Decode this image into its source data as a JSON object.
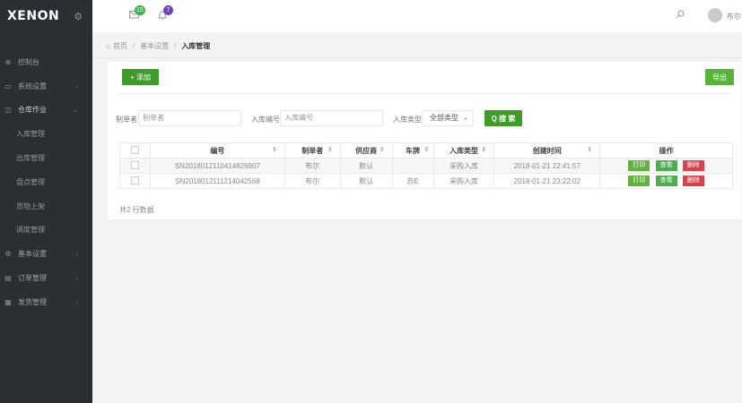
{
  "brand": {
    "logo": "XENON",
    "gear": "⚙"
  },
  "sidebar": {
    "items": [
      {
        "icon": "⊕",
        "label": "控制台",
        "arrow": "",
        "sub": false
      },
      {
        "icon": "▭",
        "label": "系统设置",
        "arrow": "›",
        "sub": false
      },
      {
        "icon": "◫",
        "label": "仓库作业",
        "arrow": "⌄",
        "sub": false,
        "open": true
      },
      {
        "icon": "",
        "label": "入库管理",
        "arrow": "",
        "sub": true
      },
      {
        "icon": "",
        "label": "出库管理",
        "arrow": "",
        "sub": true
      },
      {
        "icon": "",
        "label": "盘点管理",
        "arrow": "",
        "sub": true
      },
      {
        "icon": "",
        "label": "货物上架",
        "arrow": "",
        "sub": true
      },
      {
        "icon": "",
        "label": "调度管理",
        "arrow": "",
        "sub": true
      },
      {
        "icon": "⚙",
        "label": "基本设置",
        "arrow": "›",
        "sub": false
      },
      {
        "icon": "▤",
        "label": "订单管理",
        "arrow": "›",
        "sub": false
      },
      {
        "icon": "▦",
        "label": "发货管理",
        "arrow": "›",
        "sub": false
      }
    ]
  },
  "topbar": {
    "mail_badge": "15",
    "bell_badge": "7",
    "user_name": "布尔"
  },
  "breadcrumb": {
    "home": "首页",
    "level1": "基本设置",
    "current": "入库管理",
    "sep": "/"
  },
  "toolbar": {
    "add_label": "+ 添加",
    "export_label": "导出"
  },
  "filters": {
    "creator_label": "制单者",
    "creator_placeholder": "制单者",
    "number_label": "入库编号",
    "number_placeholder": "入库编号",
    "type_label": "入库类型",
    "type_value": "全部类型",
    "search_label": "Q 搜 索"
  },
  "table": {
    "headers": [
      "编号",
      "制单者",
      "供应商",
      "车牌",
      "入库类型",
      "创建时间",
      "操作"
    ],
    "rows": [
      {
        "id": "SN201801211041482​6907",
        "creator": "布尔",
        "supplier": "默认",
        "plate": "",
        "type": "采购入库",
        "time": "2018-01-21 22:41:57"
      },
      {
        "id": "SN2018012111214042568",
        "creator": "布尔",
        "supplier": "默认",
        "plate": "苏E",
        "type": "采购入库",
        "time": "2018-01-21 23:22:02"
      }
    ],
    "ops": {
      "print": "打印",
      "view": "查看",
      "delete": "删除"
    }
  },
  "footer": {
    "summary": "共2 行数据"
  },
  "colors": {
    "sidebar": "#2b2f33",
    "primary_green": "#3e9d29",
    "delete_red": "#d7434b",
    "badge_purple": "#6f42c1"
  }
}
